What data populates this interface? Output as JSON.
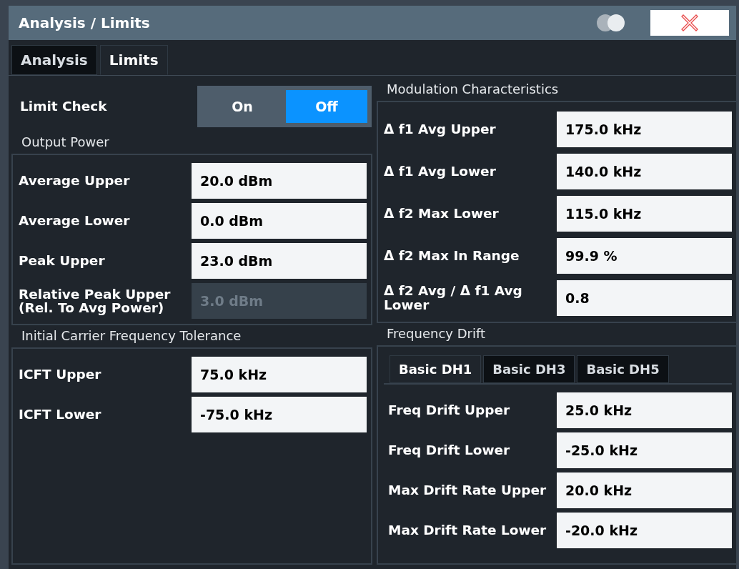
{
  "window": {
    "title": "Analysis / Limits"
  },
  "tabs": [
    {
      "label": "Analysis",
      "selected": false
    },
    {
      "label": "Limits",
      "selected": true
    }
  ],
  "limit_check": {
    "label": "Limit Check",
    "options": [
      {
        "label": "On",
        "selected": false
      },
      {
        "label": "Off",
        "selected": true
      }
    ]
  },
  "output_power": {
    "title": "Output Power",
    "rows": [
      {
        "label": "Average Upper",
        "value": "20.0 dBm",
        "disabled": false
      },
      {
        "label": "Average Lower",
        "value": "0.0 dBm",
        "disabled": false
      },
      {
        "label": "Peak Upper",
        "value": "23.0 dBm",
        "disabled": false
      },
      {
        "label": "Relative Peak Upper (Rel. To Avg Power)",
        "value": "3.0 dBm",
        "disabled": true
      }
    ]
  },
  "icft": {
    "title": "Initial Carrier Frequency Tolerance",
    "rows": [
      {
        "label": "ICFT Upper",
        "value": "75.0 kHz",
        "disabled": false
      },
      {
        "label": "ICFT Lower",
        "value": "-75.0 kHz",
        "disabled": false
      }
    ]
  },
  "modulation": {
    "title": "Modulation Characteristics",
    "rows": [
      {
        "label": "Δ f1 Avg Upper",
        "value": "175.0 kHz",
        "disabled": false
      },
      {
        "label": "Δ f1 Avg Lower",
        "value": "140.0 kHz",
        "disabled": false
      },
      {
        "label": "Δ f2 Max Lower",
        "value": "115.0 kHz",
        "disabled": false
      },
      {
        "label": "Δ f2 Max In Range",
        "value": "99.9 %",
        "disabled": false
      },
      {
        "label": "Δ f2 Avg / Δ f1 Avg Lower",
        "value": "0.8",
        "disabled": false
      }
    ]
  },
  "frequency_drift": {
    "title": "Frequency Drift",
    "tabs": [
      {
        "label": "Basic DH1",
        "selected": true
      },
      {
        "label": "Basic DH3",
        "selected": false
      },
      {
        "label": "Basic DH5",
        "selected": false
      }
    ],
    "rows": [
      {
        "label": "Freq Drift Upper",
        "value": "25.0 kHz",
        "disabled": false
      },
      {
        "label": "Freq Drift Lower",
        "value": "-25.0 kHz",
        "disabled": false
      },
      {
        "label": "Max Drift Rate Upper",
        "value": "20.0 kHz",
        "disabled": false
      },
      {
        "label": "Max Drift Rate Lower",
        "value": "-20.0 kHz",
        "disabled": false
      }
    ]
  }
}
